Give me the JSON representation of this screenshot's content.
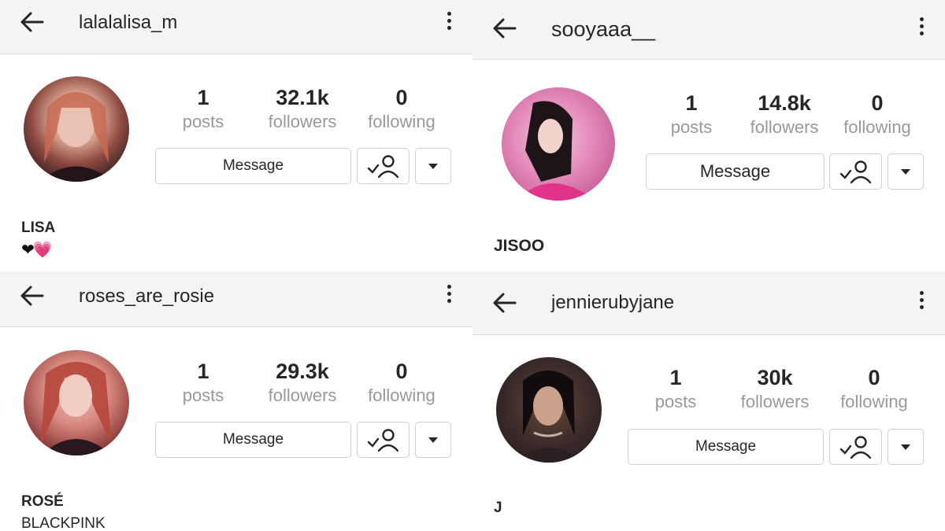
{
  "panels": [
    {
      "username": "lalalalisa_m",
      "stats": {
        "posts": "1",
        "posts_label": "posts",
        "followers": "32.1k",
        "followers_label": "followers",
        "following": "0",
        "following_label": "following"
      },
      "message_label": "Message",
      "name": "LISA",
      "bio": "❤💗"
    },
    {
      "username": "sooyaaa__",
      "stats": {
        "posts": "1",
        "posts_label": "posts",
        "followers": "14.8k",
        "followers_label": "followers",
        "following": "0",
        "following_label": "following"
      },
      "message_label": "Message",
      "name": "JISOO",
      "bio": ""
    },
    {
      "username": "roses_are_rosie",
      "stats": {
        "posts": "1",
        "posts_label": "posts",
        "followers": "29.3k",
        "followers_label": "followers",
        "following": "0",
        "following_label": "following"
      },
      "message_label": "Message",
      "name": "ROSÉ",
      "bio": "BLACKPINK"
    },
    {
      "username": "jennierubyjane",
      "stats": {
        "posts": "1",
        "posts_label": "posts",
        "followers": "30k",
        "followers_label": "followers",
        "following": "0",
        "following_label": "following"
      },
      "message_label": "Message",
      "name": "J",
      "bio": ""
    }
  ],
  "icons": {
    "back": "arrow-left-icon",
    "menu": "more-vertical-icon",
    "following": "user-check-icon",
    "dropdown": "caret-down-icon"
  },
  "colors": {
    "stat_label": "#999999",
    "header_bg": "#f4f4f4",
    "border": "#d0d0d0"
  }
}
